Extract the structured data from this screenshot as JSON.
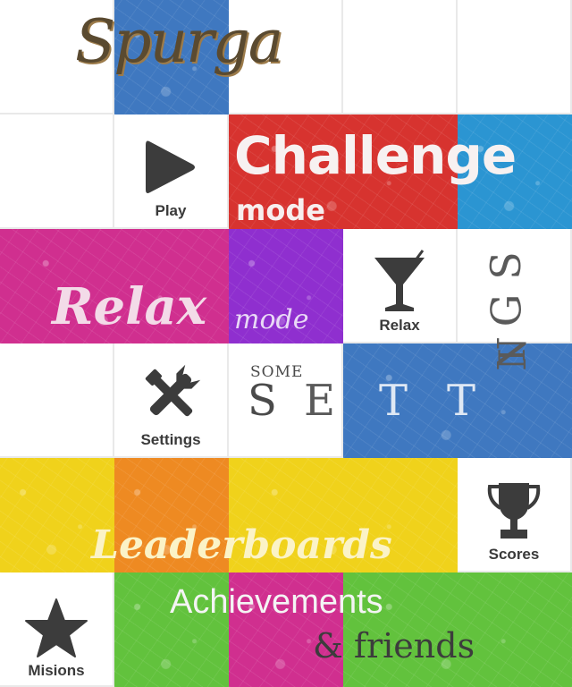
{
  "logo": {
    "text": "Spurga"
  },
  "play": {
    "label": "Play"
  },
  "challenge": {
    "title": "Challenge",
    "subtitle": "mode"
  },
  "relax_mode": {
    "title": "Relax",
    "subtitle": "mode"
  },
  "relax": {
    "label": "Relax"
  },
  "settings_icon": {
    "label": "Settings"
  },
  "some_settings": {
    "small": "SOME",
    "letters": [
      "S",
      "E",
      "T",
      "T",
      "I",
      "N",
      "G",
      "S"
    ]
  },
  "leaderboards": {
    "title": "Leaderboards"
  },
  "scores": {
    "label": "Scores"
  },
  "missions": {
    "label": "Misions"
  },
  "achievements": {
    "line1": "Achievements",
    "line2": "& friends"
  },
  "colors": {
    "blue": "#3f78c0",
    "red": "#d7332f",
    "cyan": "#2b95d2",
    "magenta": "#d02f8f",
    "purple": "#8f2fcf",
    "yellow": "#f0d21b",
    "orange": "#ee8a22",
    "green": "#62c23d",
    "icon": "#3c3c3c"
  }
}
